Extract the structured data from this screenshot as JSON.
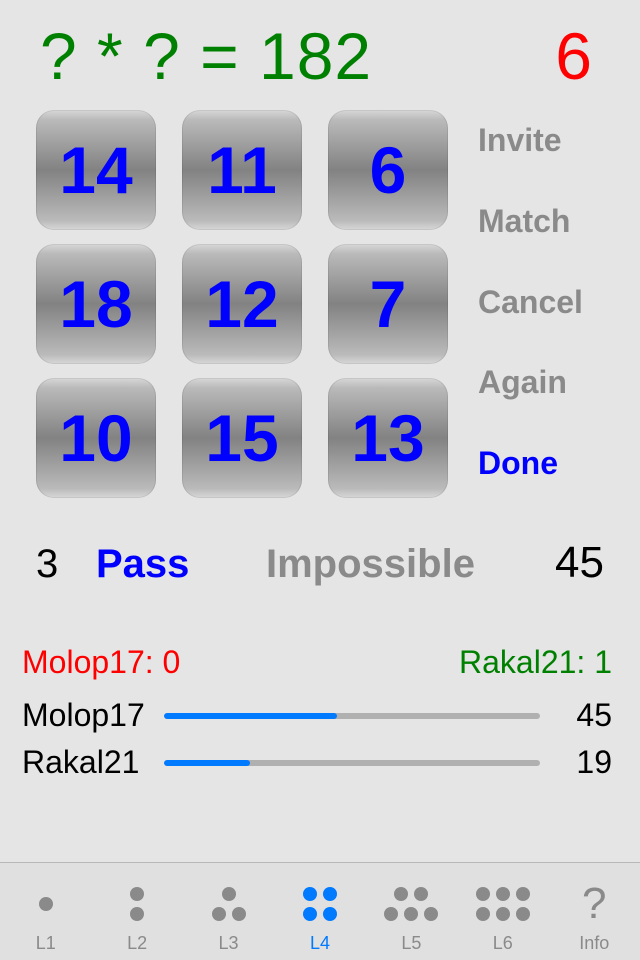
{
  "header": {
    "equation": "? * ? = 182",
    "timer": "6"
  },
  "grid": {
    "tiles": [
      "14",
      "11",
      "6",
      "18",
      "12",
      "7",
      "10",
      "15",
      "13"
    ]
  },
  "sidebar": {
    "invite": "Invite",
    "match": "Match",
    "cancel": "Cancel",
    "again": "Again",
    "done": "Done"
  },
  "status": {
    "left": "3",
    "pass": "Pass",
    "impossible": "Impossible",
    "right": "45"
  },
  "scores": {
    "player1_header": "Molop17: 0",
    "player2_header": "Rakal21: 1",
    "player1_name": "Molop17",
    "player1_val": "45",
    "player1_pct": 46,
    "player2_name": "Rakal21",
    "player2_val": "19",
    "player2_pct": 23
  },
  "tabs": {
    "l1": "L1",
    "l2": "L2",
    "l3": "L3",
    "l4": "L4",
    "l5": "L5",
    "l6": "L6",
    "info": "Info",
    "info_glyph": "?",
    "active": "l4"
  }
}
